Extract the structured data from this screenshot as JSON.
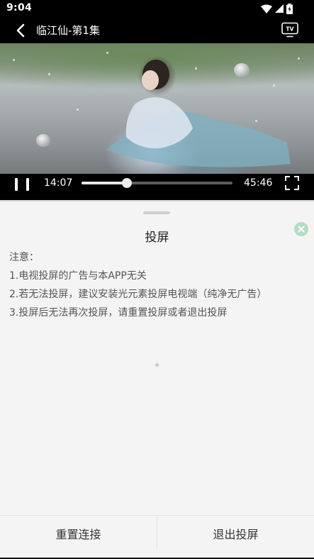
{
  "status_bar": {
    "time": "9:04"
  },
  "header": {
    "title": "临江仙-第1集",
    "tv_icon_label": "TV"
  },
  "player": {
    "current_time": "14:07",
    "total_time": "45:46",
    "progress_fraction": 0.3
  },
  "cast_sheet": {
    "title": "投屏",
    "notes": [
      "注意：",
      "1.电视投屏的广告与本APP无关",
      "2.若无法投屏，建议安装光元素投屏电视端（纯净无广告）",
      "3.投屏后无法再次投屏，请重置投屏或者退出投屏"
    ],
    "reset_label": "重置连接",
    "exit_label": "退出投屏"
  },
  "colors": {
    "close_badge": "#b5dcc5",
    "sheet_background": "#f4f4f4"
  }
}
